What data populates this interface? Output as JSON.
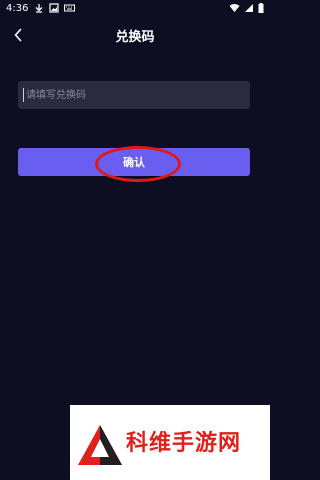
{
  "status_bar": {
    "time": "4:36"
  },
  "header": {
    "title": "兑换码"
  },
  "redeem_input": {
    "placeholder": "请填写兑换码",
    "value": ""
  },
  "confirm_button": {
    "label": "确认"
  },
  "watermark": {
    "text": "科维手游网"
  },
  "colors": {
    "background": "#0d0e22",
    "input_bg": "#2a2c3e",
    "accent": "#6a5ef0",
    "annotation": "#e01818"
  }
}
